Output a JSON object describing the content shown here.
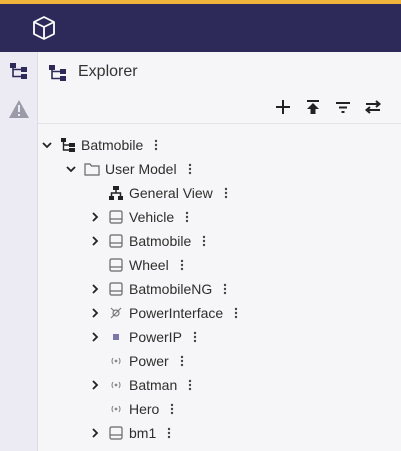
{
  "panel": {
    "title": "Explorer"
  },
  "toolbar": {
    "add": "plus-icon",
    "collapse": "collapse-all-icon",
    "filter": "filter-icon",
    "sync": "sync-icon"
  },
  "colors": {
    "accent_strip": "#f0b43c",
    "topbar": "#2d2a5a",
    "activity_bg": "#ecebf3"
  },
  "tree": {
    "root": {
      "label": "Batmobile"
    },
    "model": {
      "label": "User Model"
    },
    "items": [
      {
        "label": "General View",
        "icon": "diagram-icon",
        "expandable": false
      },
      {
        "label": "Vehicle",
        "icon": "block-icon",
        "expandable": true
      },
      {
        "label": "Batmobile",
        "icon": "block-icon",
        "expandable": true
      },
      {
        "label": "Wheel",
        "icon": "block-icon",
        "expandable": false
      },
      {
        "label": "BatmobileNG",
        "icon": "block-icon",
        "expandable": true
      },
      {
        "label": "PowerInterface",
        "icon": "interface-icon",
        "expandable": true
      },
      {
        "label": "PowerIP",
        "icon": "port-icon",
        "expandable": true
      },
      {
        "label": "Power",
        "icon": "signal-icon",
        "expandable": false
      },
      {
        "label": "Batman",
        "icon": "signal-icon",
        "expandable": true
      },
      {
        "label": "Hero",
        "icon": "signal-icon",
        "expandable": false
      },
      {
        "label": "bm1",
        "icon": "block-icon",
        "expandable": true
      }
    ]
  }
}
